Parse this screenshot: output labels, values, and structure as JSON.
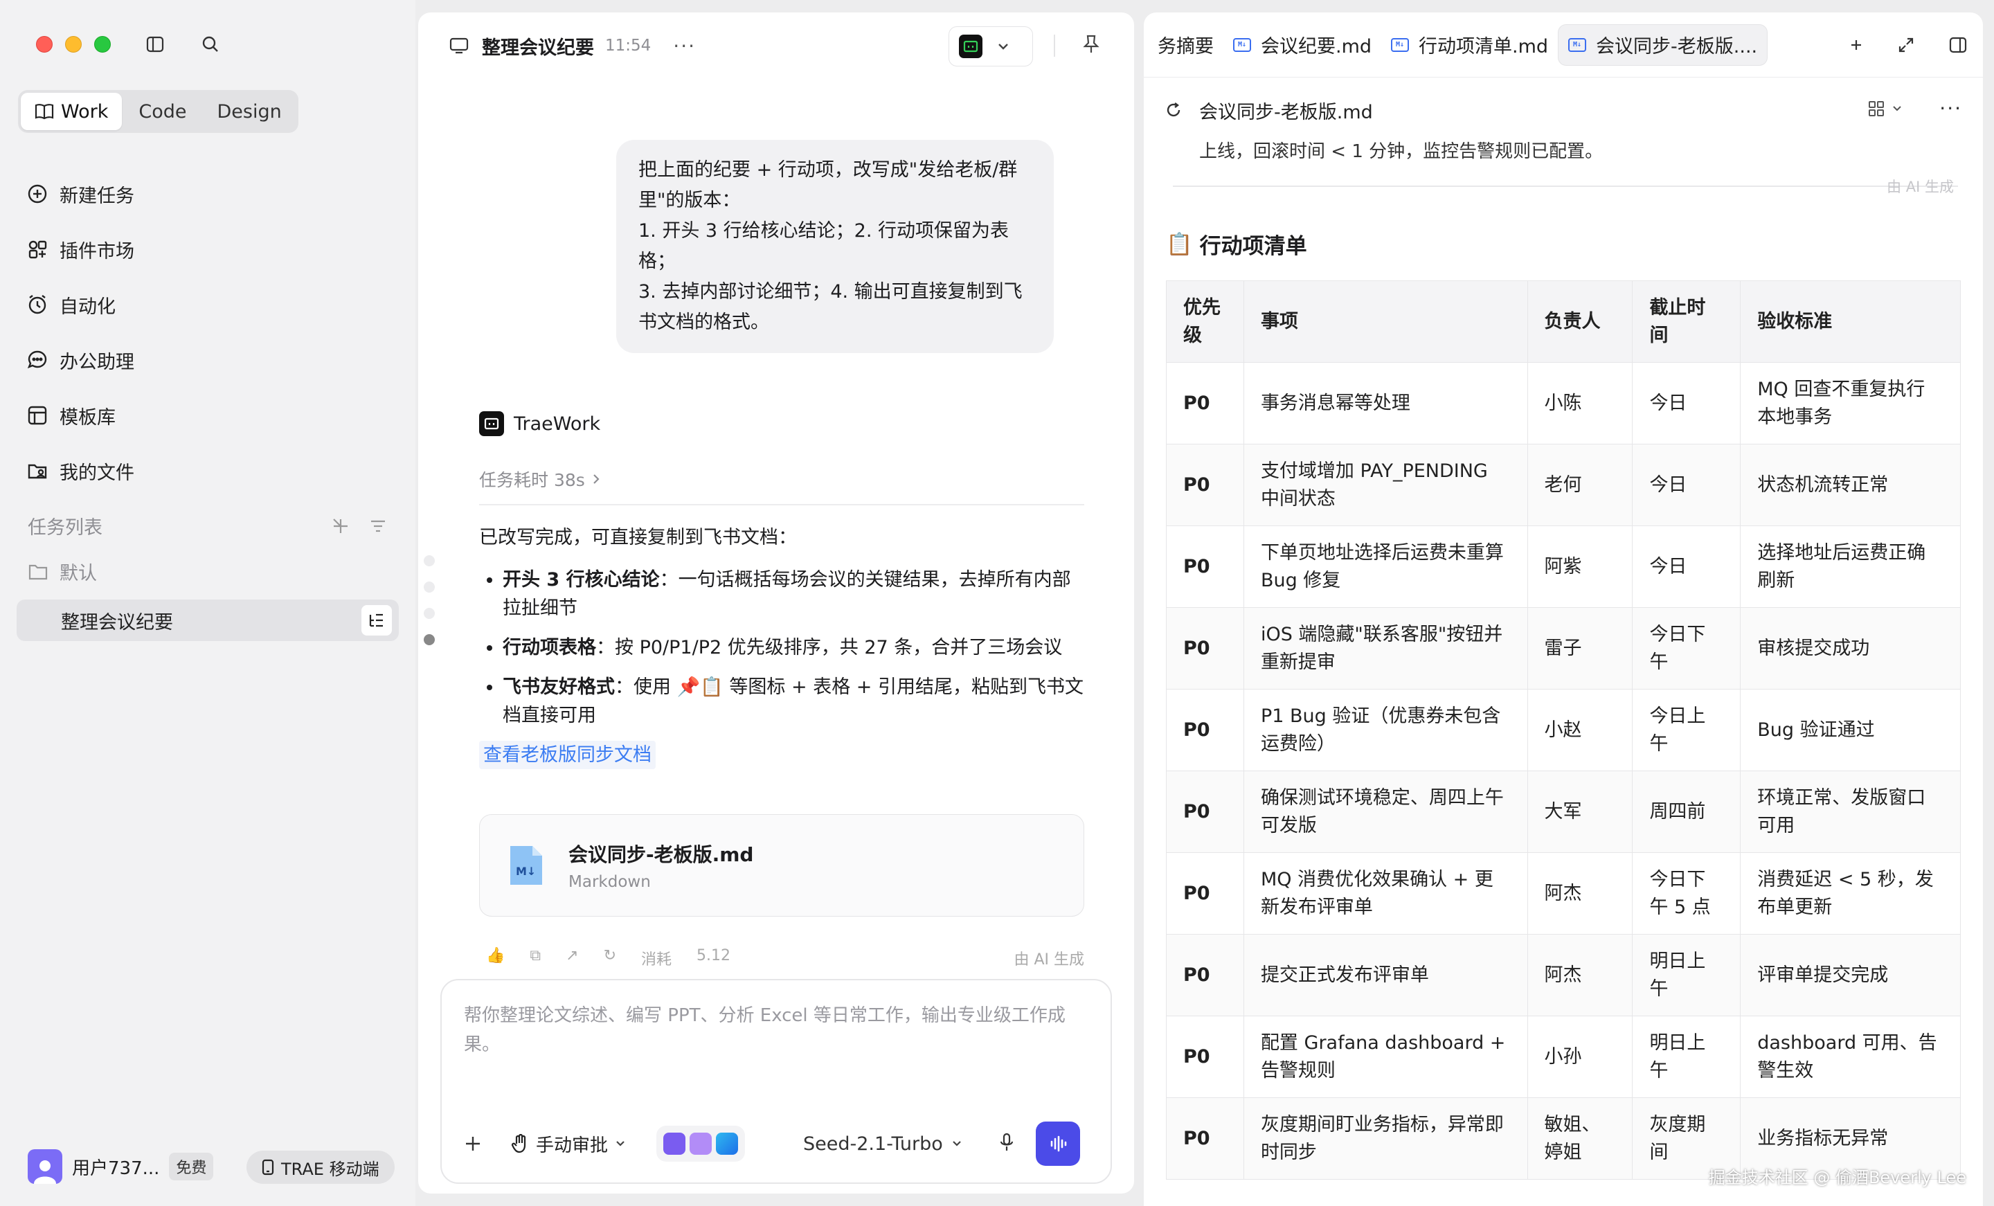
{
  "sidebar": {
    "modes": [
      {
        "label": "Work",
        "icon": "book-icon",
        "active": true
      },
      {
        "label": "Code",
        "active": false
      },
      {
        "label": "Design",
        "active": false
      }
    ],
    "nav": [
      {
        "label": "新建任务",
        "icon": "plus-circle-icon"
      },
      {
        "label": "插件市场",
        "icon": "plugin-icon"
      },
      {
        "label": "自动化",
        "icon": "alarm-icon"
      },
      {
        "label": "办公助理",
        "icon": "chat-icon"
      },
      {
        "label": "模板库",
        "icon": "template-icon"
      },
      {
        "label": "我的文件",
        "icon": "folder-user-icon"
      }
    ],
    "tasks_header": "任务列表",
    "folder": "默认",
    "task_item": "整理会议纪要",
    "user_name": "用户737...",
    "plan_badge": "免费",
    "mobile_label": "TRAE 移动端"
  },
  "chat": {
    "title": "整理会议纪要",
    "time": "11:54",
    "more": "···",
    "user_message": "把上面的纪要 + 行动项，改写成\"发给老板/群里\"的版本：\n1. 开头 3 行给核心结论；2. 行动项保留为表格；\n3. 去掉内部讨论细节；4. 输出可直接复制到飞书文档的格式。",
    "bot_name": "TraeWork",
    "elapsed": "任务耗时 38s",
    "answer_intro": "已改写完成，可直接复制到飞书文档：",
    "bullets": [
      {
        "bold": "开头 3 行核心结论",
        "text": "：一句话概括每场会议的关键结果，去掉所有内部拉扯细节"
      },
      {
        "bold": "行动项表格",
        "text": "：按 P0/P1/P2 优先级排序，共 27 条，合并了三场会议"
      },
      {
        "bold": "飞书友好格式",
        "text": "：使用 📌📋 等图标 + 表格 + 引用结尾，粘贴到飞书文档直接可用"
      }
    ],
    "link_text": "查看老板版同步文档",
    "file_name": "会议同步-老板版.md",
    "file_type": "Markdown",
    "usage_label": "消耗",
    "usage_value": "5.12",
    "ai_generated": "由 AI 生成",
    "composer_placeholder": "帮你整理论文综述、编写 PPT、分析 Excel 等日常工作，输出专业级工作成果。",
    "approve_label": "手动审批",
    "model_label": "Seed-2.1-Turbo"
  },
  "doc": {
    "tabs": [
      {
        "label": "务摘要",
        "md": false
      },
      {
        "label": "会议纪要.md",
        "md": true
      },
      {
        "label": "行动项清单.md",
        "md": true
      },
      {
        "label": "会议同步-老板版....",
        "md": true,
        "active": true
      }
    ],
    "file_title": "会议同步-老板版.md",
    "cut_line": "上线，回滚时间 < 1 分钟，监控告警规则已配置。",
    "ai_tag": "由 AI 生成",
    "section_icon": "📋",
    "section_title": "行动项清单",
    "table": {
      "headers": [
        "优先级",
        "事项",
        "负责人",
        "截止时间",
        "验收标准"
      ],
      "rows": [
        [
          "P0",
          "事务消息幂等处理",
          "小陈",
          "今日",
          "MQ 回查不重复执行本地事务"
        ],
        [
          "P0",
          "支付域增加 PAY_PENDING 中间状态",
          "老何",
          "今日",
          "状态机流转正常"
        ],
        [
          "P0",
          "下单页地址选择后运费未重算 Bug 修复",
          "阿紫",
          "今日",
          "选择地址后运费正确刷新"
        ],
        [
          "P0",
          "iOS 端隐藏\"联系客服\"按钮并重新提审",
          "雷子",
          "今日下午",
          "审核提交成功"
        ],
        [
          "P0",
          "P1 Bug 验证（优惠券未包含运费险）",
          "小赵",
          "今日上午",
          "Bug 验证通过"
        ],
        [
          "P0",
          "确保测试环境稳定、周四上午可发版",
          "大军",
          "周四前",
          "环境正常、发版窗口可用"
        ],
        [
          "P0",
          "MQ 消费优化效果确认 + 更新发布评审单",
          "阿杰",
          "今日下午 5 点",
          "消费延迟 < 5 秒，发布单更新"
        ],
        [
          "P0",
          "提交正式发布评审单",
          "阿杰",
          "明日上午",
          "评审单提交完成"
        ],
        [
          "P0",
          "配置 Grafana dashboard + 告警规则",
          "小孙",
          "明日上午",
          "dashboard 可用、告警生效"
        ],
        [
          "P0",
          "灰度期间盯业务指标，异常即时同步",
          "敏姐、婷姐",
          "灰度期间",
          "业务指标无异常"
        ]
      ]
    },
    "watermark": "掘金技术社区 @ 偷酒Beverly Lee"
  }
}
